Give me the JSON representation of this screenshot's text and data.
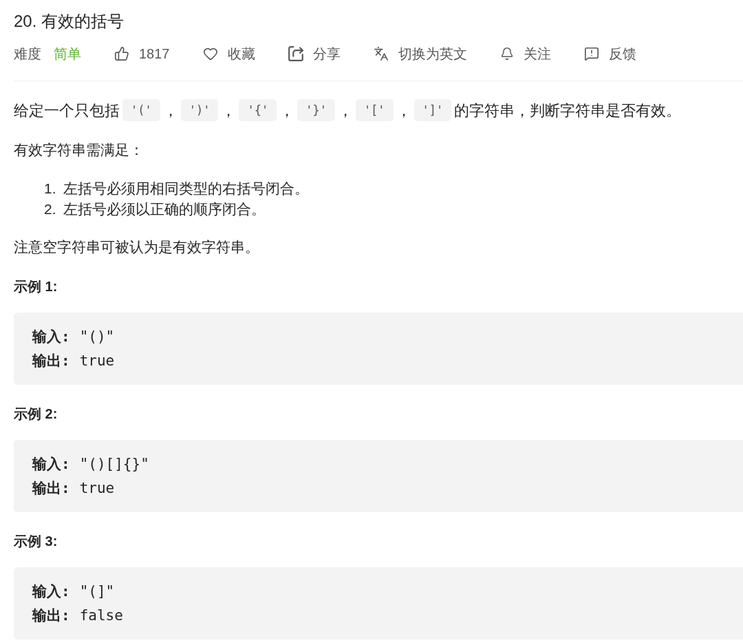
{
  "title": "20. 有效的括号",
  "meta": {
    "difficulty_label": "难度",
    "difficulty": {
      "kind": "easy",
      "text": "简单"
    },
    "actions": [
      {
        "kind": "like",
        "label": "1817"
      },
      {
        "kind": "favorite",
        "label": "收藏"
      },
      {
        "kind": "share",
        "label": "分享"
      },
      {
        "kind": "translate",
        "label": "切换为英文"
      },
      {
        "kind": "follow",
        "label": "关注"
      },
      {
        "kind": "feedback",
        "label": "反馈"
      }
    ]
  },
  "description": {
    "intro": [
      {
        "kind": "text",
        "text": "给定一个只包括"
      },
      {
        "kind": "code",
        "text": "'('"
      },
      {
        "kind": "text",
        "text": "，"
      },
      {
        "kind": "code",
        "text": "')'"
      },
      {
        "kind": "text",
        "text": "，"
      },
      {
        "kind": "code",
        "text": "'{'"
      },
      {
        "kind": "text",
        "text": "，"
      },
      {
        "kind": "code",
        "text": "'}'"
      },
      {
        "kind": "text",
        "text": "，"
      },
      {
        "kind": "code",
        "text": "'['"
      },
      {
        "kind": "text",
        "text": "，"
      },
      {
        "kind": "code",
        "text": "']'"
      },
      {
        "kind": "text",
        "text": "的字符串，判断字符串是否有效。"
      }
    ],
    "rules_intro": "有效字符串需满足：",
    "rules": [
      {
        "number": "1.",
        "text": "左括号必须用相同类型的右括号闭合。"
      },
      {
        "number": "2.",
        "text": "左括号必须以正确的顺序闭合。"
      }
    ],
    "note": "注意空字符串可被认为是有效字符串。"
  },
  "examples": [
    {
      "heading": "示例 1:",
      "lines": [
        {
          "label": "输入:",
          "value": "\"()\""
        },
        {
          "label": "输出:",
          "value": "true"
        }
      ]
    },
    {
      "heading": "示例 2:",
      "lines": [
        {
          "label": "输入:",
          "value": "\"()[]{}\""
        },
        {
          "label": "输出:",
          "value": "true"
        }
      ]
    },
    {
      "heading": "示例 3:",
      "lines": [
        {
          "label": "输入:",
          "value": "\"(]\""
        },
        {
          "label": "输出:",
          "value": "false"
        }
      ]
    }
  ]
}
